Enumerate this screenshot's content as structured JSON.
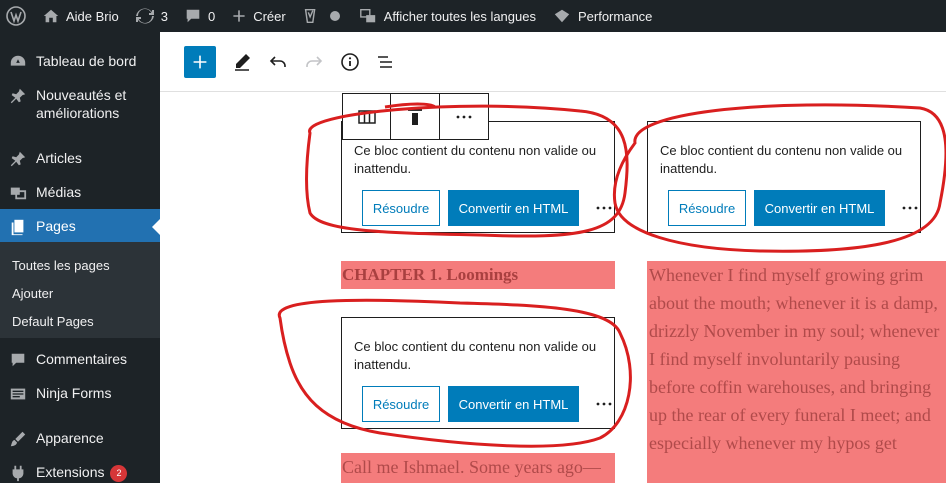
{
  "admin_bar": {
    "site_name": "Aide Brio",
    "updates_count": "3",
    "comments_count": "0",
    "new_label": "Créer",
    "languages_label": "Afficher toutes les langues",
    "performance_label": "Performance"
  },
  "sidebar": {
    "items": [
      {
        "label": "Tableau de bord",
        "icon": "dashboard-icon"
      },
      {
        "label": "Nouveautés et améliorations",
        "icon": "pin-icon"
      },
      {
        "label": "Articles",
        "icon": "pin-icon"
      },
      {
        "label": "Médias",
        "icon": "media-icon"
      },
      {
        "label": "Pages",
        "icon": "pages-icon"
      },
      {
        "label": "Commentaires",
        "icon": "comments-icon"
      },
      {
        "label": "Ninja Forms",
        "icon": "form-icon"
      },
      {
        "label": "Apparence",
        "icon": "brush-icon"
      },
      {
        "label": "Extensions",
        "icon": "plugin-icon",
        "badge": "2"
      }
    ],
    "submenu": [
      "Toutes les pages",
      "Ajouter",
      "Default Pages"
    ]
  },
  "editor": {
    "invalid_message": "Ce bloc contient du contenu non valide ou inattendu.",
    "resolve_label": "Résoudre",
    "convert_label": "Convertir en HTML",
    "more_label": "⋮",
    "heading": "CHAPTER 1. Loomings",
    "para_left": "Call me Ishmael. Some years ago—",
    "para_right": "Whenever I find myself growing grim about the mouth; whenever it is a damp, drizzly November in my soul; whenever I find myself involuntarily pausing before coffin warehouses, and bringing up the rear of every funeral I meet; and especially whenever my hypos get"
  },
  "colors": {
    "accent": "#007cba",
    "admin_bg": "#1d2327",
    "highlight": "#f47c7c",
    "annotation": "#d91f1f"
  }
}
